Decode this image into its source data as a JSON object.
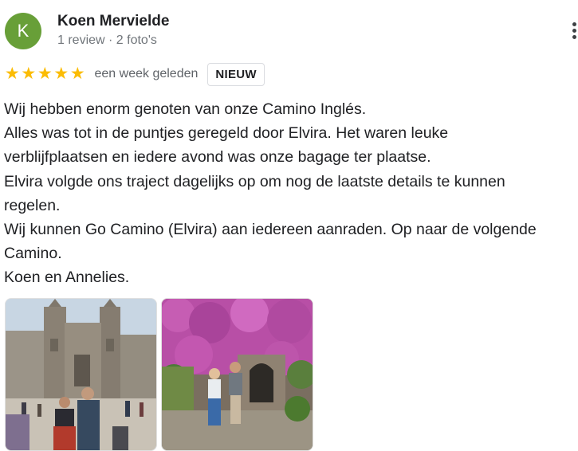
{
  "reviewer": {
    "initial": "K",
    "name": "Koen Mervielde",
    "meta": "1 review · 2 foto's",
    "avatar_color": "#689f38"
  },
  "rating": {
    "stars": 5,
    "star_glyph": "★",
    "star_color": "#fbbc04",
    "time": "een week geleden",
    "badge": "NIEUW"
  },
  "review_lines": [
    "Wij hebben enorm genoten van onze Camino Inglés.",
    "Alles was tot in de puntjes geregeld door Elvira. Het waren leuke",
    "verblijfplaatsen en iedere avond was onze bagage ter plaatse.",
    "Elvira volgde ons traject dagelijks op om nog de laatste details te kunnen",
    "regelen.",
    "Wij kunnen Go Camino (Elvira) aan iedereen aanraden. Op naar de volgende",
    "Camino.",
    "Koen en Annelies."
  ],
  "photos": [
    {
      "subject": "cathedral-square-photo"
    },
    {
      "subject": "flower-wall-photo"
    }
  ],
  "icons": {
    "more": "more-vert-icon"
  }
}
